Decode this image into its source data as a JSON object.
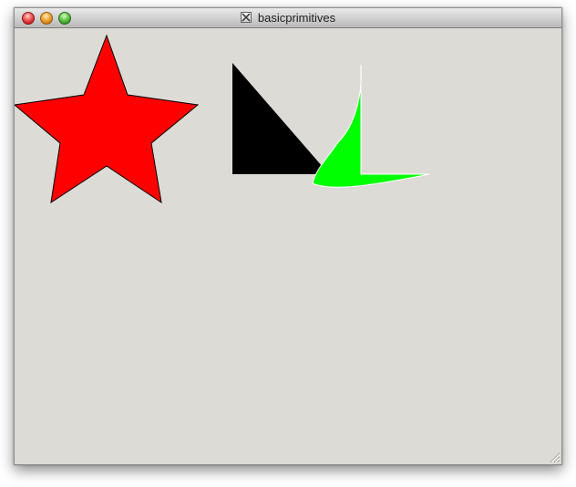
{
  "window": {
    "title": "basicprimitives",
    "title_icon": "x11-icon",
    "background_color": "#dcdbd6"
  },
  "traffic_lights": [
    {
      "name": "close",
      "color": "#e0443e"
    },
    {
      "name": "minimize",
      "color": "#f2a33a"
    },
    {
      "name": "zoom",
      "color": "#57c038"
    }
  ],
  "primitives": {
    "star": {
      "fill": "#ff0000",
      "stroke": "#000000",
      "points": 5
    },
    "triangle": {
      "fill": "#000000"
    },
    "curve": {
      "fill": "#00ff00",
      "stroke": "#ffffff"
    }
  }
}
